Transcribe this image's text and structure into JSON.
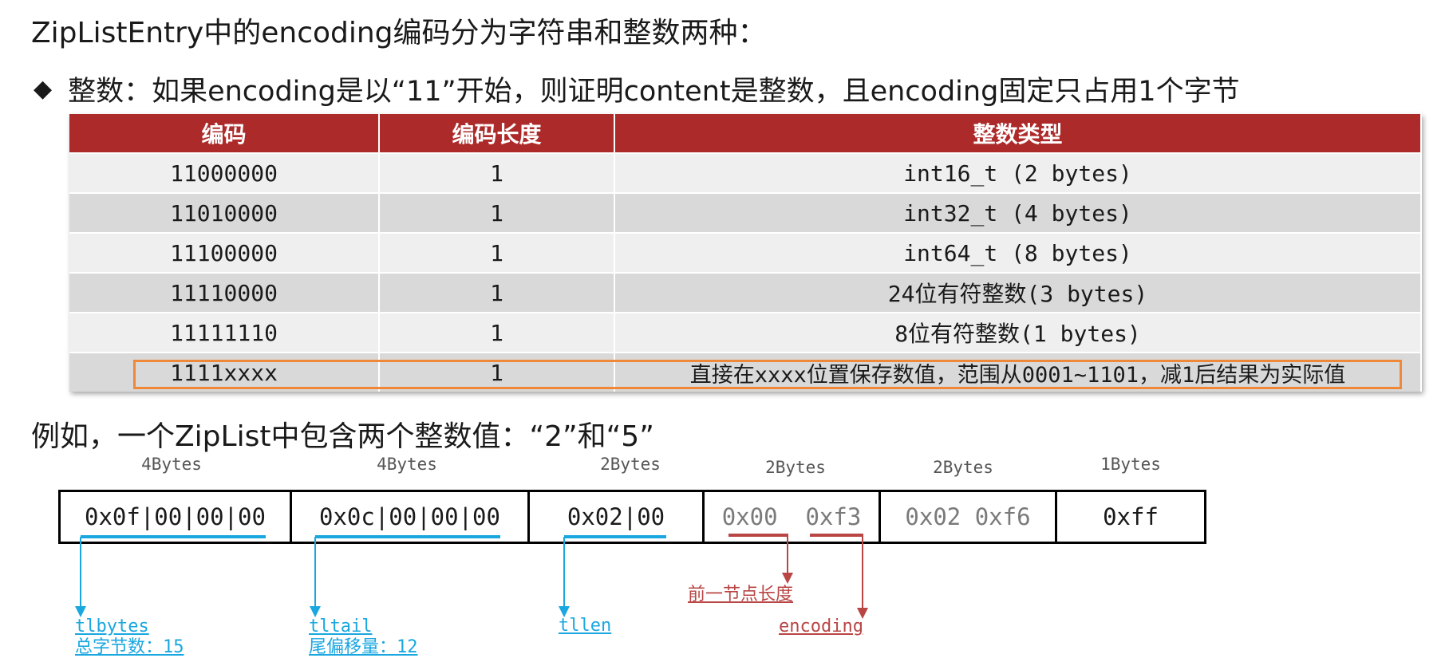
{
  "title": "ZipListEntry中的encoding编码分为字符串和整数两种：",
  "bullet": {
    "mark": "◆",
    "text": "整数：如果encoding是以“11”开始，则证明content是整数，且encoding固定只占用1个字节"
  },
  "table": {
    "headers": [
      "编码",
      "编码长度",
      "整数类型"
    ],
    "rows": [
      [
        "11000000",
        "1",
        "int16_t (2 bytes)"
      ],
      [
        "11010000",
        "1",
        "int32_t (4 bytes)"
      ],
      [
        "11100000",
        "1",
        "int64_t (8 bytes)"
      ],
      [
        "11110000",
        "1",
        "24位有符整数(3 bytes)"
      ],
      [
        "11111110",
        "1",
        "8位有符整数(1 bytes)"
      ],
      [
        "1111xxxx",
        "1",
        "直接在xxxx位置保存数值，范围从0001~1101，减1后结果为实际值"
      ]
    ]
  },
  "example": {
    "text": "例如，一个ZipList中包含两个整数值：“2”和“5”",
    "byte_labels": [
      "4Bytes",
      "4Bytes",
      "2Bytes",
      "2Bytes",
      "2Bytes",
      "1Bytes"
    ],
    "boxes": [
      "0x0f|00|00|00",
      "0x0c|00|00|00",
      "0x02|00",
      "0x00  0xf3",
      "0x02 0xf6",
      "0xff"
    ],
    "annotations": {
      "tlbytes": {
        "name": "tlbytes",
        "desc": "总字节数：15"
      },
      "tltail": {
        "name": "tltail",
        "desc": "尾偏移量：12"
      },
      "tllen": {
        "name": "tllen"
      },
      "prevlen": {
        "name": "前一节点长度"
      },
      "encoding": {
        "name": "encoding"
      }
    },
    "colors": {
      "blue": "#1aa7e0",
      "red": "#b94545",
      "header": "#ad2a2a",
      "highlight": "#f0883a"
    }
  }
}
